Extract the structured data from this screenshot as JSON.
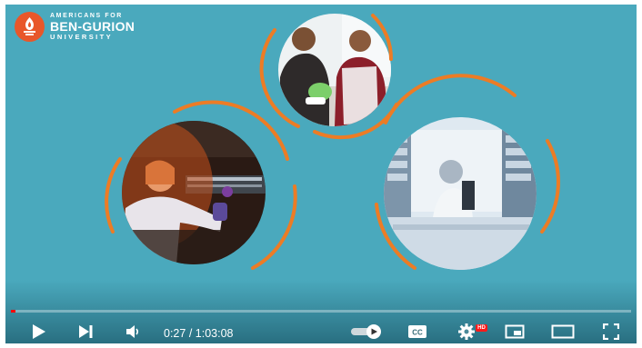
{
  "logo": {
    "line1": "AMERICANS FOR",
    "line2": "BEN-GURION",
    "line3": "UNIVERSITY"
  },
  "player": {
    "current_time": "0:27",
    "duration": "1:03:08",
    "time_separator": " / ",
    "progress": 0.007,
    "settings_badge": "HD",
    "accent_color": "#ff0000",
    "background_color": "#4aa9bd",
    "ring_color": "#ec7c25"
  },
  "icons": {
    "play": "play-icon",
    "next": "next-icon",
    "volume": "volume-icon",
    "autoplay": "autoplay-toggle-icon",
    "captions": "captions-icon",
    "settings": "gear-icon",
    "miniplayer": "miniplayer-icon",
    "theater": "theater-icon",
    "fullscreen": "fullscreen-icon"
  }
}
